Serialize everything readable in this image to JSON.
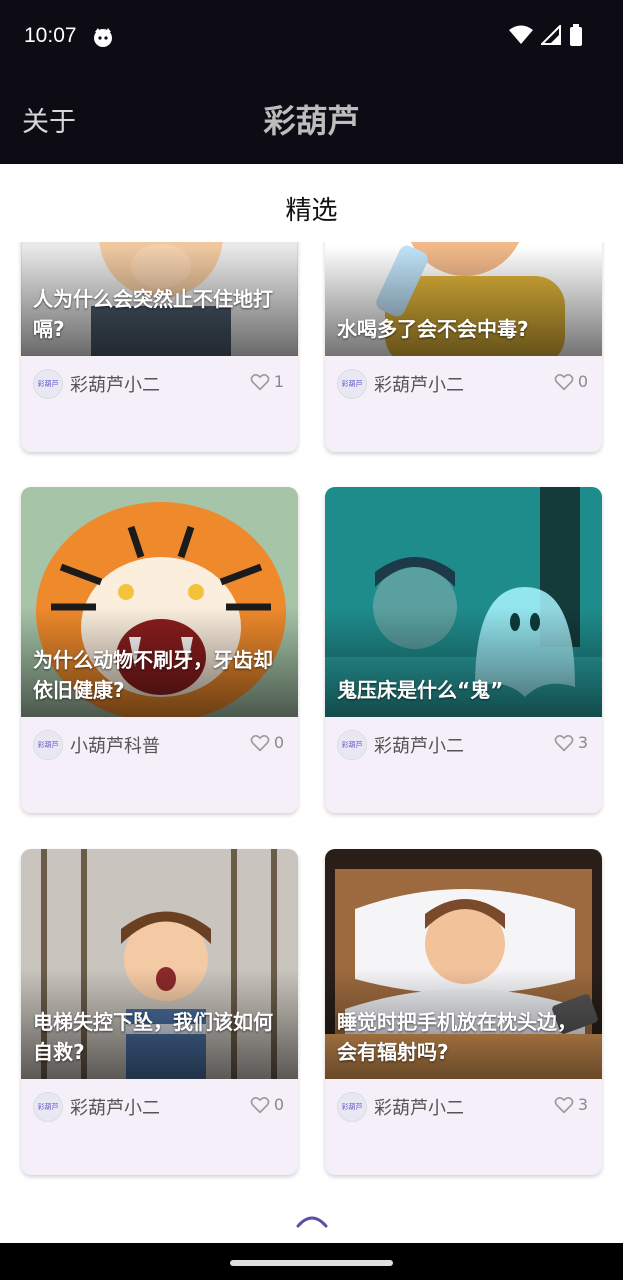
{
  "status_bar": {
    "time": "10:07"
  },
  "app_bar": {
    "left_action": "关于",
    "title": "彩葫芦"
  },
  "section": {
    "title": "精选"
  },
  "cards": [
    {
      "caption": "人为什么会突然止不住地打嗝?",
      "author": "彩葫芦小二",
      "likes": "1",
      "avatar_text": "彩葫芦"
    },
    {
      "caption": "水喝多了会不会中毒?",
      "author": "彩葫芦小二",
      "likes": "0",
      "avatar_text": "彩葫芦"
    },
    {
      "caption": "为什么动物不刷牙，牙齿却依旧健康?",
      "author": "小葫芦科普",
      "likes": "0",
      "avatar_text": "彩葫芦"
    },
    {
      "caption": "鬼压床是什么“鬼”",
      "author": "彩葫芦小二",
      "likes": "3",
      "avatar_text": "彩葫芦"
    },
    {
      "caption": "电梯失控下坠，我们该如何自救?",
      "author": "彩葫芦小二",
      "likes": "0",
      "avatar_text": "彩葫芦"
    },
    {
      "caption": "睡觉时把手机放在枕头边，会有辐射吗?",
      "author": "彩葫芦小二",
      "likes": "3",
      "avatar_text": "彩葫芦"
    }
  ],
  "colors": {
    "bar_bg": "#0d0b14",
    "card_bg": "#f4eff8",
    "accent": "#5b4fa8"
  }
}
